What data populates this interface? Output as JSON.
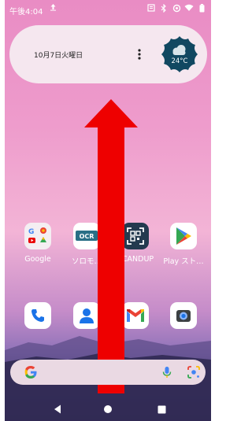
{
  "status_bar": {
    "time": "午後4:04",
    "upload_icon": "upload-arrow-icon",
    "icons": [
      "notification-box-icon",
      "bluetooth-icon",
      "wifi-icon",
      "battery-icon"
    ]
  },
  "widget": {
    "date": "10月7日火曜日",
    "menu_icon": "more-vert-icon",
    "weather_temp": "24°C",
    "weather_icon": "cloud-icon"
  },
  "apps_row1": [
    {
      "label": "Google",
      "icon": "google-folder-icon"
    },
    {
      "label": "ソロモ…",
      "icon": "ocr-app-icon"
    },
    {
      "label": "SCANDUP",
      "icon": "scandup-icon"
    },
    {
      "label": "Play スト…",
      "icon": "play-store-icon"
    }
  ],
  "apps_row2": [
    {
      "label": "",
      "icon": "phone-icon"
    },
    {
      "label": "",
      "icon": "contacts-icon"
    },
    {
      "label": "",
      "icon": "gmail-icon"
    },
    {
      "label": "",
      "icon": "camera-icon"
    }
  ],
  "ocr_text": "OCR",
  "search": {
    "g_letter": "G",
    "mic_icon": "mic-icon",
    "lens_icon": "lens-icon"
  },
  "nav": [
    "back-icon",
    "home-icon",
    "recents-icon"
  ],
  "overlay": {
    "arrow_icon": "swipe-up-arrow-icon",
    "color": "#ee0000"
  }
}
